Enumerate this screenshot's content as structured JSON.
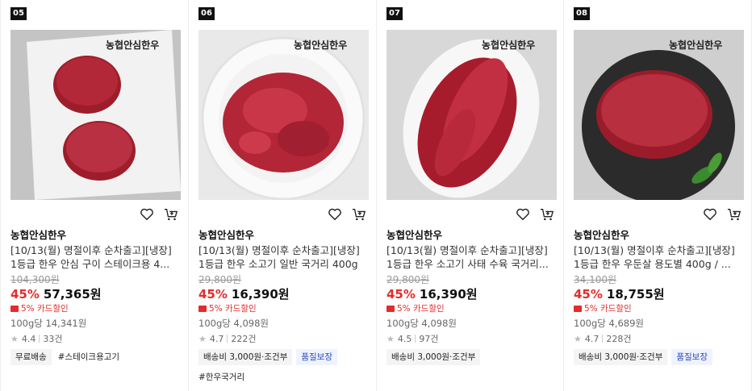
{
  "products": [
    {
      "rank": "05",
      "brand": "농협안심한우",
      "title_line1": "[10/13(월) 명절이후 순차출고][냉장]",
      "title_line2": "1등급 한우 안심 구이 스테이크용 4...",
      "original_price": "104,300원",
      "discount_rate": "45%",
      "price": "57,365원",
      "card_discount": "5% 카드할인",
      "unit_price": "100g당 14,341원",
      "rating": "4.4",
      "review_count": "33건",
      "tags": [
        {
          "label": "무료배송",
          "style": "gray"
        },
        {
          "label": "#스테이크용고기",
          "style": "plain"
        }
      ],
      "extra_tag": "",
      "image_logo": "농협안심한우"
    },
    {
      "rank": "06",
      "brand": "농협안심한우",
      "title_line1": "[10/13(월) 명절이후 순차출고][냉장]",
      "title_line2": "1등급 한우 소고기 일반 국거리 400g",
      "original_price": "29,800원",
      "discount_rate": "45%",
      "price": "16,390원",
      "card_discount": "5% 카드할인",
      "unit_price": "100g당 4,098원",
      "rating": "4.7",
      "review_count": "222건",
      "tags": [
        {
          "label": "배송비 3,000원·조건부",
          "style": "gray"
        },
        {
          "label": "품질보장",
          "style": "blue"
        }
      ],
      "extra_tag": "#한우국거리",
      "image_logo": "농협안심한우"
    },
    {
      "rank": "07",
      "brand": "농협안심한우",
      "title_line1": "[10/13(월) 명절이후 순차출고][냉장]",
      "title_line2": "1등급 한우 소고기 사태 수육 국거리...",
      "original_price": "29,800원",
      "discount_rate": "45%",
      "price": "16,390원",
      "card_discount": "5% 카드할인",
      "unit_price": "100g당 4,098원",
      "rating": "4.5",
      "review_count": "97건",
      "tags": [
        {
          "label": "배송비 3,000원·조건부",
          "style": "gray"
        }
      ],
      "extra_tag": "",
      "image_logo": "농협안심한우"
    },
    {
      "rank": "08",
      "brand": "농협안심한우",
      "title_line1": "[10/13(월) 명절이후 순차출고][냉장]",
      "title_line2": "1등급 한우 우둔살 용도별 400g / ...",
      "original_price": "34,100원",
      "discount_rate": "45%",
      "price": "18,755원",
      "card_discount": "5% 카드할인",
      "unit_price": "100g당 4,689원",
      "rating": "4.7",
      "review_count": "228건",
      "tags": [
        {
          "label": "배송비 3,000원·조건부",
          "style": "gray"
        },
        {
          "label": "품질보장",
          "style": "blue"
        }
      ],
      "extra_tag": "",
      "image_logo": "농협안심한우"
    }
  ],
  "icons": {
    "wishlist": "heart-icon",
    "cart": "cart-icon",
    "star": "star-icon"
  },
  "colors": {
    "discount": "#e52b2b",
    "rank_badge": "#111111",
    "quality_tag_text": "#2e4db8"
  }
}
